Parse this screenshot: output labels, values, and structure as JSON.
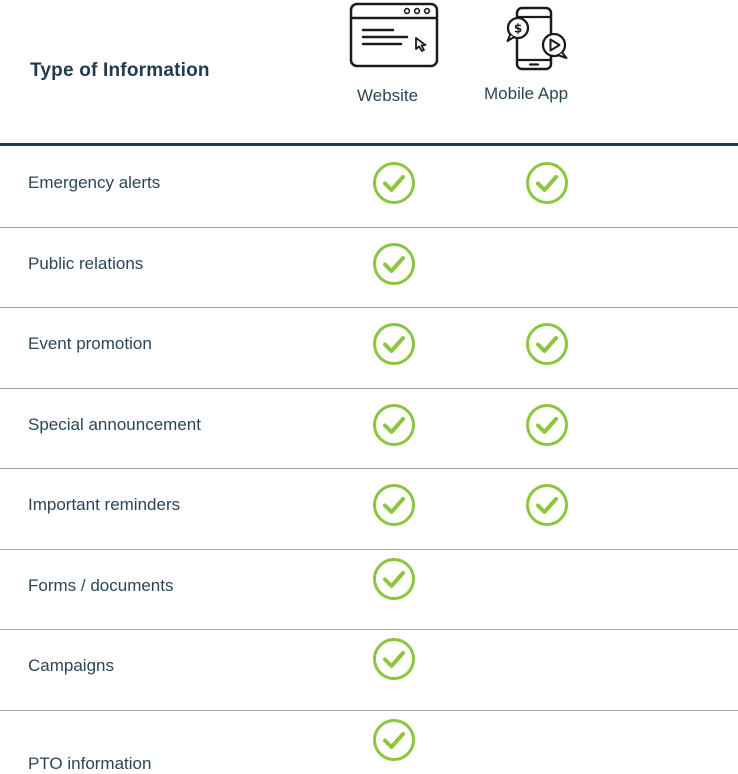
{
  "header": {
    "type_label": "Type of Information",
    "columns": [
      {
        "label": "Website",
        "icon": "browser-window-icon"
      },
      {
        "label": "Mobile App",
        "icon": "mobile-app-icon"
      }
    ]
  },
  "check_icon": "check-circle-icon",
  "check_color": "#8cc63f",
  "rows": [
    {
      "label": "Emergency alerts",
      "website": true,
      "mobile_app": true
    },
    {
      "label": "Public relations",
      "website": true,
      "mobile_app": false
    },
    {
      "label": "Event promotion",
      "website": true,
      "mobile_app": true
    },
    {
      "label": "Special announcement",
      "website": true,
      "mobile_app": true
    },
    {
      "label": "Important reminders",
      "website": true,
      "mobile_app": true
    },
    {
      "label": "Forms / documents",
      "website": true,
      "mobile_app": false
    },
    {
      "label": "Campaigns",
      "website": true,
      "mobile_app": false
    },
    {
      "label": "PTO information",
      "website": true,
      "mobile_app": false
    }
  ]
}
